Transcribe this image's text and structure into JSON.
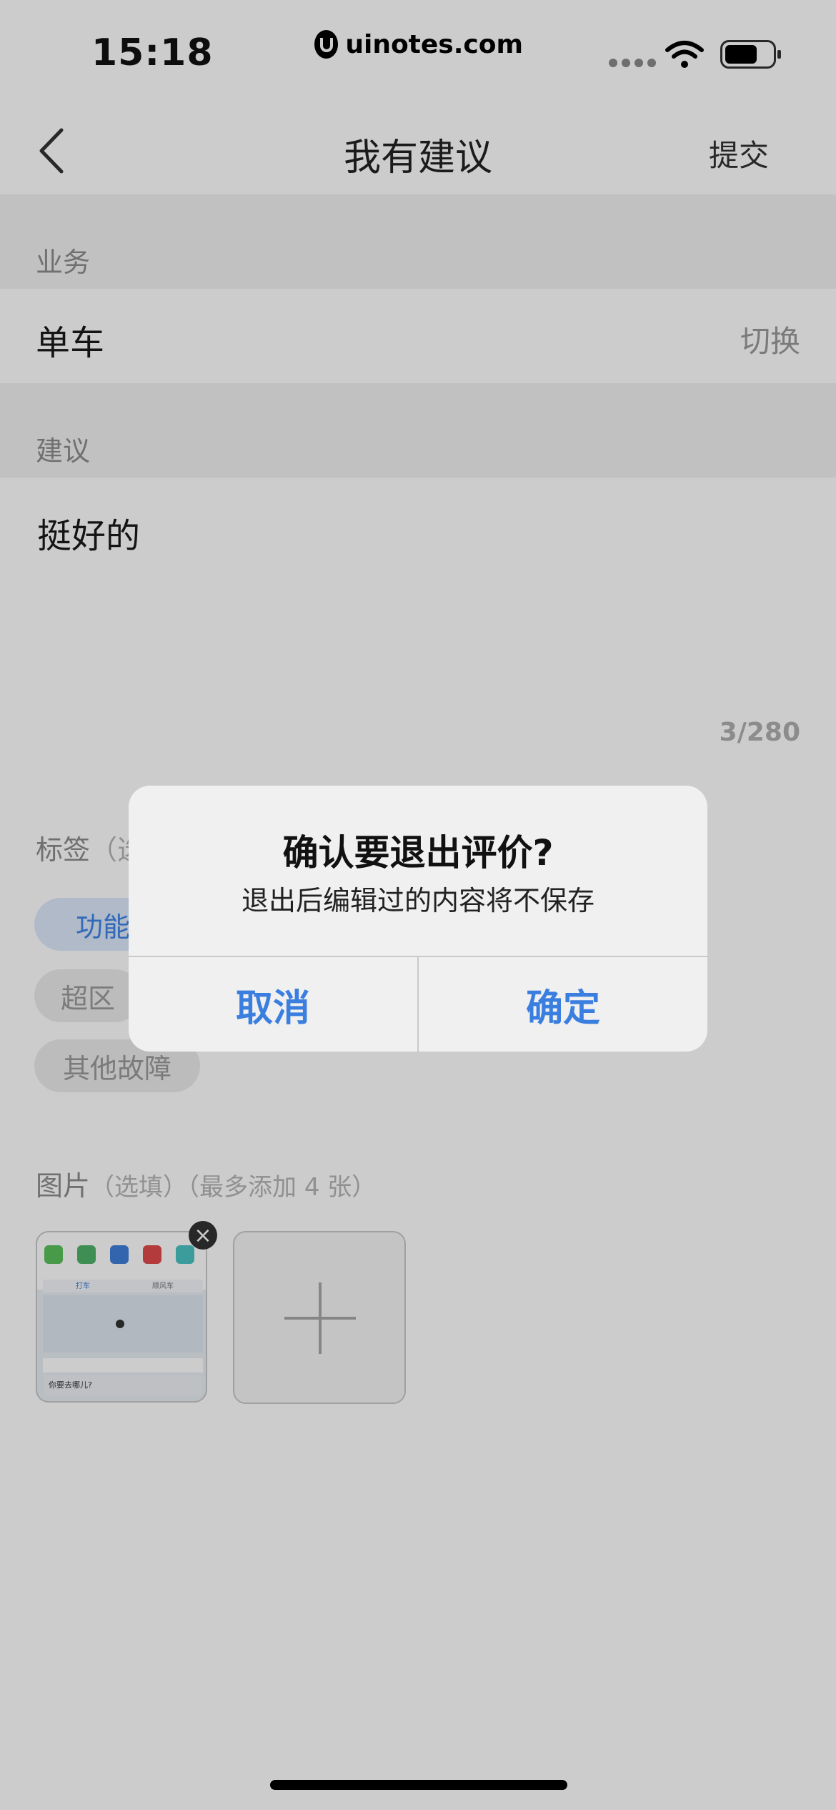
{
  "status_bar": {
    "time": "15:18",
    "site": "uinotes.com"
  },
  "nav": {
    "title": "我有建议",
    "submit_label": "提交"
  },
  "business": {
    "label": "业务",
    "value": "单车",
    "switch_label": "切换"
  },
  "suggestion": {
    "label": "建议",
    "text": "挺好的",
    "counter": "3/280"
  },
  "tags": {
    "label": "标签",
    "label_hint": "（选",
    "items": [
      {
        "label": "功能建",
        "active": true
      },
      {
        "label": "超区",
        "active": false
      },
      {
        "label": "其他故障",
        "active": false
      }
    ]
  },
  "images": {
    "label": "图片",
    "hint": "（选填）（最多添加 4 张）",
    "thumb_tabs": [
      "打车",
      "顺风车"
    ],
    "thumb_search": "你要去哪儿?"
  },
  "alert": {
    "title": "确认要退出评价?",
    "message": "退出后编辑过的内容将不保存",
    "cancel_label": "取消",
    "confirm_label": "确定"
  },
  "colors": {
    "accent": "#3a7ee0",
    "tag_active_bg": "#dde9fb",
    "page_bg": "#f2f2f2"
  }
}
